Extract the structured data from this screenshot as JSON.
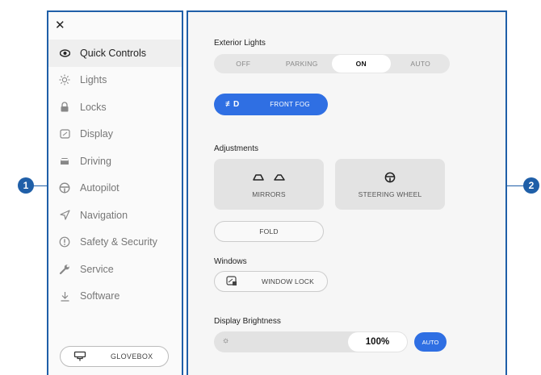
{
  "callouts": {
    "left": "1",
    "right": "2"
  },
  "sidebar": {
    "close_label": "✕",
    "items": [
      {
        "label": "Quick Controls",
        "icon": "eye-icon",
        "active": true
      },
      {
        "label": "Lights",
        "icon": "sun-icon"
      },
      {
        "label": "Locks",
        "icon": "lock-icon"
      },
      {
        "label": "Display",
        "icon": "display-icon"
      },
      {
        "label": "Driving",
        "icon": "car-icon"
      },
      {
        "label": "Autopilot",
        "icon": "steering-wheel-icon"
      },
      {
        "label": "Navigation",
        "icon": "navigation-arrow-icon"
      },
      {
        "label": "Safety & Security",
        "icon": "alert-circle-icon"
      },
      {
        "label": "Service",
        "icon": "wrench-icon"
      },
      {
        "label": "Software",
        "icon": "download-icon"
      }
    ],
    "glovebox_label": "GLOVEBOX"
  },
  "main": {
    "exterior_lights": {
      "title": "Exterior Lights",
      "options": [
        "OFF",
        "PARKING",
        "ON",
        "AUTO"
      ],
      "selected": "ON"
    },
    "front_fog": {
      "icon_text": "≢D",
      "label": "FRONT FOG"
    },
    "adjustments": {
      "title": "Adjustments",
      "mirrors_label": "MIRRORS",
      "steering_label": "STEERING WHEEL",
      "fold_label": "FOLD"
    },
    "windows": {
      "title": "Windows",
      "lock_label": "WINDOW LOCK"
    },
    "brightness": {
      "title": "Display Brightness",
      "sun_glyph": "☼",
      "value": "100%",
      "auto_label": "AUTO"
    }
  },
  "colors": {
    "accent": "#2f6fe3",
    "callout": "#1f5fa8"
  }
}
